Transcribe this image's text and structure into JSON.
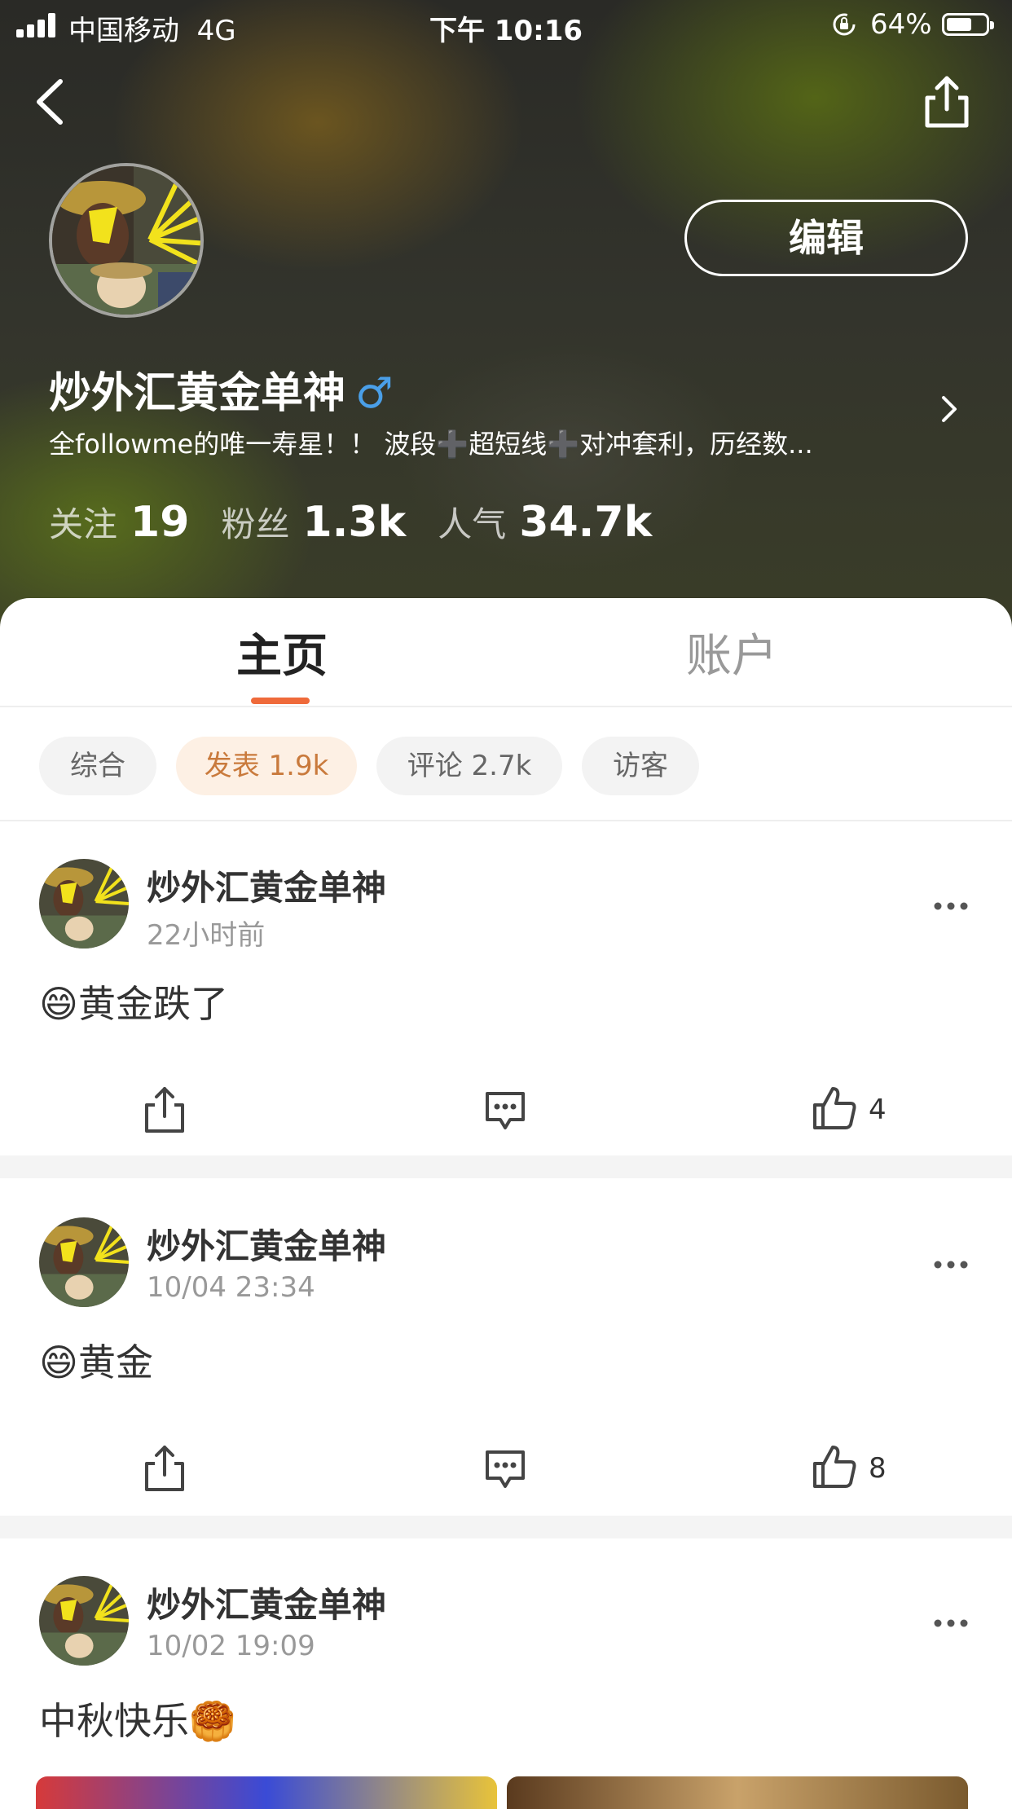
{
  "status_bar": {
    "carrier": "中国移动",
    "network": "4G",
    "time": "下午 10:16",
    "battery": "64%"
  },
  "header": {
    "edit_label": "编辑",
    "username": "炒外汇黄金单神",
    "gender_symbol": "♂",
    "bio": "全followme的唯一寿星！！ 波段➕超短线➕对冲套利，历经数...",
    "stats": [
      {
        "label": "关注",
        "value": "19"
      },
      {
        "label": "粉丝",
        "value": "1.3k"
      },
      {
        "label": "人气",
        "value": "34.7k"
      }
    ]
  },
  "tabs": {
    "main": "主页",
    "account": "账户"
  },
  "filters": [
    {
      "label": "综合"
    },
    {
      "label": "发表 1.9k"
    },
    {
      "label": "评论 2.7k"
    },
    {
      "label": "访客"
    }
  ],
  "posts": [
    {
      "author": "炒外汇黄金单神",
      "time": "22小时前",
      "text": "😄黄金跌了",
      "likes": "4"
    },
    {
      "author": "炒外汇黄金单神",
      "time": "10/04 23:34",
      "text": "😄黄金",
      "likes": "8"
    },
    {
      "author": "炒外汇黄金单神",
      "time": "10/02 19:09",
      "text": "中秋快乐🥮"
    }
  ],
  "colors": {
    "accent": "#ef6a3a",
    "gender": "#4a9fe8",
    "chip_active_bg": "#fdf0e4",
    "chip_active_text": "#c97a3c"
  },
  "icons": [
    "back-icon",
    "share-icon",
    "chevron-right-icon",
    "more-icon",
    "comment-icon",
    "like-icon",
    "lock-rotation-icon"
  ]
}
